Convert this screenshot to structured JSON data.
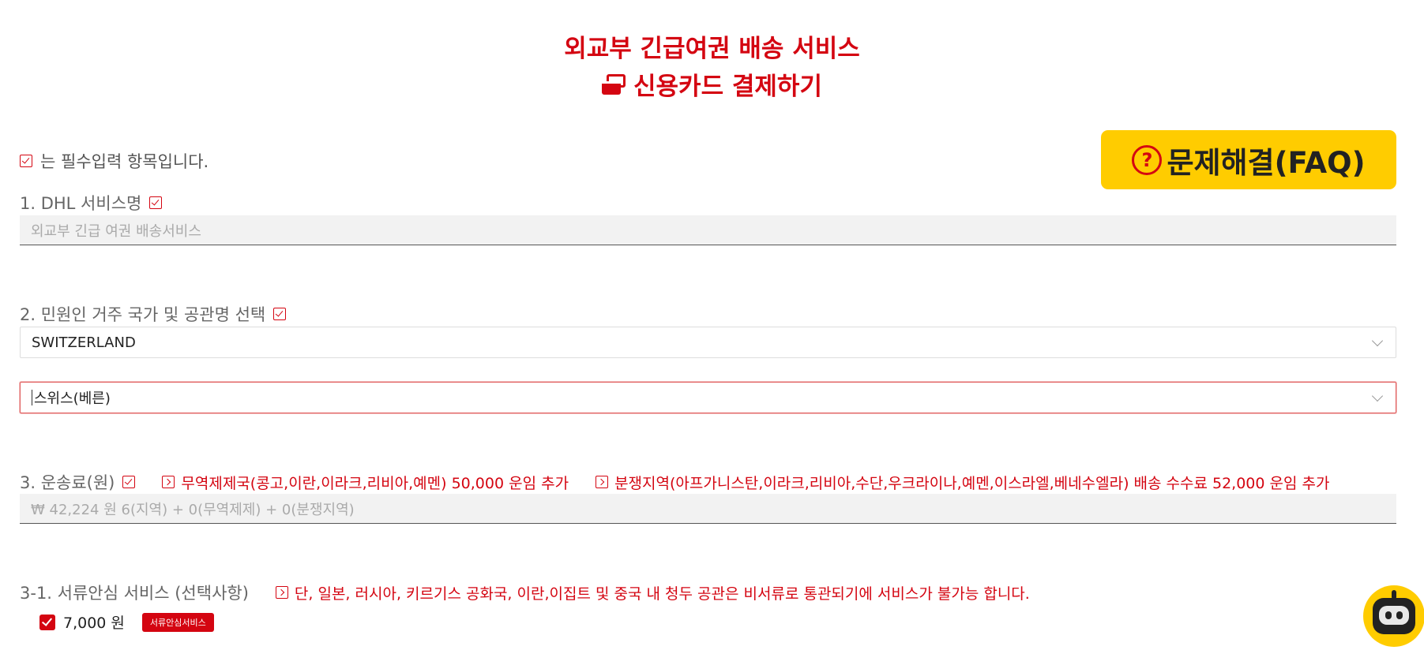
{
  "header": {
    "title": "외교부 긴급여권 배송 서비스",
    "subtitle": "신용카드 결제하기"
  },
  "required_note": "는 필수입력 항목입니다.",
  "faq_button": {
    "icon": "?",
    "label": "문제해결(FAQ)"
  },
  "section1": {
    "label": "1. DHL 서비스명",
    "value": "외교부 긴급 여권 배송서비스"
  },
  "section2": {
    "label": "2. 민원인 거주 국가 및 공관명 선택",
    "country": "SWITZERLAND",
    "embassy": "스위스(베른)"
  },
  "section3": {
    "label": "3. 운송료(원)",
    "notice1": "무역제제국(콩고,이란,이라크,리비아,예멘) 50,000 운임 추가",
    "notice2": "분쟁지역(아프가니스탄,이라크,리비아,수단,우크라이나,예멘,이스라엘,베네수엘라) 배송 수수료 52,000 운임 추가",
    "value": "₩ 42,224 원 6(지역) + 0(무역제제) + 0(분쟁지역)"
  },
  "section3_1": {
    "label": "3-1. 서류안심 서비스 (선택사항)",
    "notice": "단, 일본, 러시아, 키르기스 공화국, 이란,이집트 및 중국 내 청두 공관은 비서류로 통관되기에 서비스가 불가능 합니다.",
    "option_price": "7,000 원",
    "option_badge": "서류안심서비스",
    "option_checked": true
  },
  "colors": {
    "accent": "#d40511",
    "faq_bg": "#ffcc00"
  },
  "icons": [
    "card-icon",
    "check-icon",
    "question-icon",
    "arrow-right-icon",
    "chevron-down-icon",
    "chatbot-icon"
  ]
}
